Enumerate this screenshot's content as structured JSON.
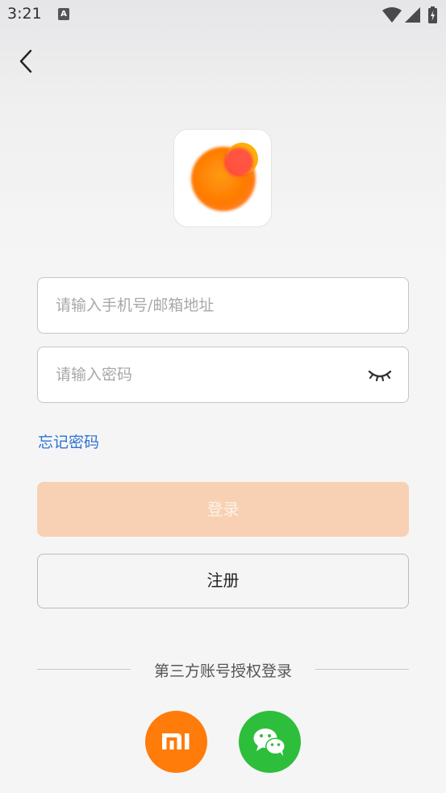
{
  "status_bar": {
    "time": "3:21",
    "notification_icon_letter": "A"
  },
  "login_form": {
    "account_placeholder": "请输入手机号/邮箱地址",
    "password_placeholder": "请输入密码",
    "forgot_password": "忘记密码",
    "login_label": "登录",
    "register_label": "注册"
  },
  "third_party": {
    "label": "第三方账号授权登录",
    "providers": [
      {
        "name": "xiaomi",
        "icon": "xiaomi-mi-icon",
        "color": "#ff7b0a"
      },
      {
        "name": "wechat",
        "icon": "wechat-icon",
        "color": "#2dbe3c"
      }
    ]
  },
  "colors": {
    "accent_link": "#2f73d2",
    "login_disabled_bg": "#f8d1b4",
    "logo_orange": "#ff7a00"
  }
}
